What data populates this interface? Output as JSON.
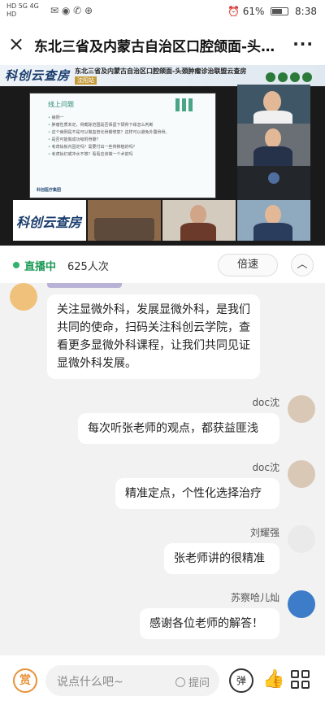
{
  "status_bar": {
    "signal_top": "HD 5G 4G",
    "signal_bottom": "HD",
    "app_icons": "✉ ◉ ✆ ⊕",
    "alarm_icon": "⏰",
    "battery_percent": "61%",
    "time": "8:38"
  },
  "header": {
    "close_icon": "×",
    "title": "东北三省及内蒙古自治区口腔颌面-头颈肿瘤诊治联盟云查房",
    "more_icon": "···"
  },
  "video": {
    "banner_logo": "科创云查房",
    "banner_title": "东北三省及内蒙古自治区口腔颌面-头颈肿瘤诊治联盟云查房",
    "banner_sub": "沈阳站",
    "slide_title": "线上问题",
    "slide_items": [
      "病例一",
      "肿瘤性质未定，骨截除范围是否保留下颌骨下缘怎么判断",
      "这个病例是不是可以做血管化骨瓣修复？这样可以避免外露骨骨。",
      "是否可能做成功吸附骨瓣？",
      "考虑钛板内固定吗？需要付出一些骨移植的吗？",
      "考虑钛钉或冲水不够？看看应该做一个术前吗"
    ],
    "slide_logo": "科创医疗集团",
    "strip_logo": "科创云查房"
  },
  "live_bar": {
    "status": "直播中",
    "viewers": "625人次",
    "speed_label": "倍速",
    "collapse_icon": "︿"
  },
  "messages": [
    {
      "user": "",
      "text": "关注显微外科，发展显微外科，是我们共同的使命，扫码关注科创云学院，查看更多显微外科课程，让我们共同见证显微外科发展。"
    },
    {
      "user": "doc沈",
      "text": "每次听张老师的观点，都获益匪浅"
    },
    {
      "user": "doc沈",
      "text": "精准定点，个性化选择治疗"
    },
    {
      "user": "刘耀强",
      "text": "张老师讲的很精准"
    },
    {
      "user": "苏察哈儿灿",
      "text": "感谢各位老师的解答！"
    }
  ],
  "bottom_bar": {
    "reward_label": "赏",
    "input_placeholder": "说点什么吧~",
    "question_label": "提问",
    "barrage_label": "弹",
    "like_icon": "👍",
    "menu_icon": "grid"
  },
  "colors": {
    "live_green": "#1c9a57",
    "reward_orange": "#e8923a"
  }
}
